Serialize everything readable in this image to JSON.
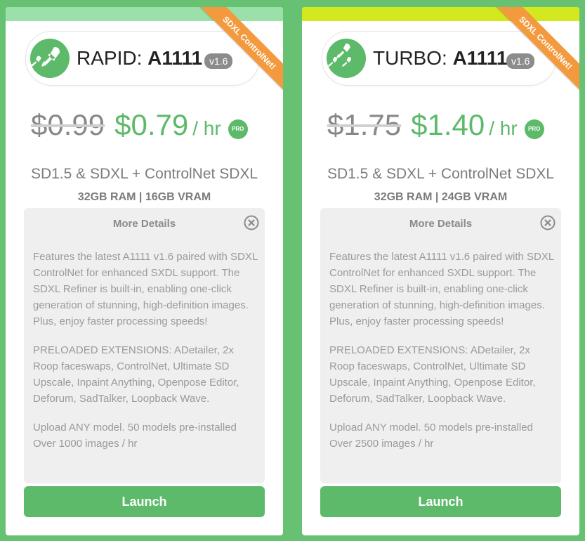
{
  "cards": [
    {
      "ribbon": "SDXL ControlNet!",
      "tier": "RAPID:",
      "name": "A1111",
      "version": "v1.6",
      "currency": "$",
      "old_price": "0.99",
      "new_price": "$0.79",
      "per_hr": "/ hr",
      "pro": "PRO",
      "subtitle": "SD1.5 & SDXL + ControlNet SDXL",
      "specs": "32GB RAM | 16GB VRAM",
      "details_title": "More Details",
      "description": "Features the latest A1111 v1.6 paired with SDXL ControlNet for enhanced SXDL support. The SDXL Refiner is built-in, enabling one-click generation of stunning, high-definition images. Plus, enjoy faster processing speeds!",
      "extensions": "PRELOADED EXTENSIONS: ADetailer, 2x Roop faceswaps, ControlNet, Ultimate SD Upscale, Inpaint Anything, Openpose Editor, Deforum, SadTalker, Loopback Wave.",
      "upload_line1": "Upload ANY model. 50 models pre-installed",
      "upload_line2": "Over 1000 images / hr",
      "launch": "Launch",
      "accent_color": "#9be0a9"
    },
    {
      "ribbon": "SDXL ControlNet!",
      "tier": "TURBO:",
      "name": "A1111",
      "version": "v1.6",
      "currency": "$",
      "old_price": "1.75",
      "new_price": "$1.40",
      "per_hr": "/ hr",
      "pro": "PRO",
      "subtitle": "SD1.5 & SDXL + ControlNet SDXL",
      "specs": "32GB RAM | 24GB VRAM",
      "details_title": "More Details",
      "description": "Features the latest A1111 v1.6 paired with SDXL ControlNet for enhanced SXDL support. The SDXL Refiner is built-in, enabling one-click generation of stunning, high-definition images. Plus, enjoy faster processing speeds!",
      "extensions": "PRELOADED EXTENSIONS: ADetailer, 2x Roop faceswaps, ControlNet, Ultimate SD Upscale, Inpaint Anything, Openpose Editor, Deforum, SadTalker, Loopback Wave.",
      "upload_line1": "Upload ANY model. 50 models pre-installed",
      "upload_line2": "Over 2500 images / hr",
      "launch": "Launch",
      "accent_color": "#d3e81e"
    }
  ],
  "colors": {
    "page_background": "#66c172",
    "primary_green": "#5dba6a",
    "ribbon_orange": "#f39a3e"
  },
  "icons": {
    "title": "rocket-icon",
    "close": "close-circle-icon"
  }
}
